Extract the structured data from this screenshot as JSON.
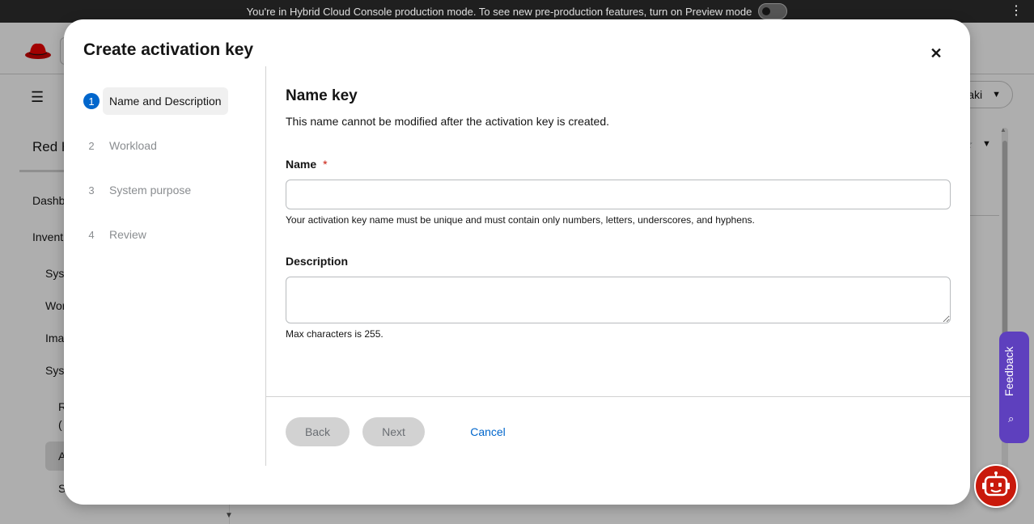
{
  "banner": {
    "text": "You're in Hybrid Cloud Console production mode. To see new pre-production features, turn on Preview mode"
  },
  "background": {
    "nav_title": "Red H",
    "nav_items": [
      "Dashb",
      "Invent",
      "Sys",
      "Wor",
      "Ima",
      "Syst",
      "R",
      "(",
      "A",
      "S"
    ],
    "user_menu": "aki"
  },
  "modal": {
    "title": "Create activation key",
    "steps": [
      {
        "num": "1",
        "label": "Name and Description"
      },
      {
        "num": "2",
        "label": "Workload"
      },
      {
        "num": "3",
        "label": "System purpose"
      },
      {
        "num": "4",
        "label": "Review"
      }
    ],
    "section_title": "Name key",
    "section_desc": "This name cannot be modified after the activation key is created.",
    "name_label": "Name",
    "required_mark": "*",
    "name_value": "",
    "name_helper": "Your activation key name must be unique and must contain only numbers, letters, underscores, and hyphens.",
    "description_label": "Description",
    "description_value": "",
    "description_helper": "Max characters is 255.",
    "buttons": {
      "back": "Back",
      "next": "Next",
      "cancel": "Cancel"
    }
  },
  "feedback": {
    "label": "Feedback"
  },
  "icons": {
    "close": "close-icon",
    "kebab": "kebab-icon",
    "chatbot": "robot-icon"
  }
}
